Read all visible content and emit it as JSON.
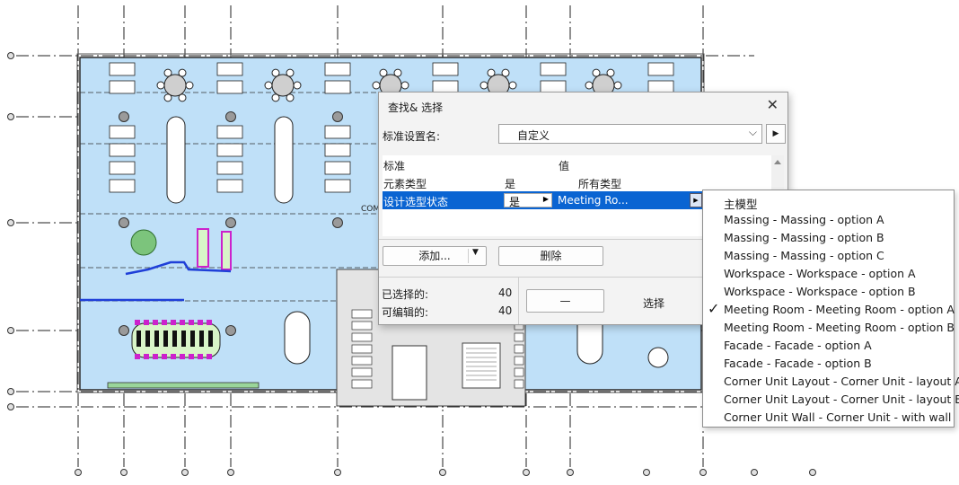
{
  "grid_bubbles": {
    "count_left": 6,
    "count_bottom": 12
  },
  "plan_labels": {
    "com_label": "COM"
  },
  "dialog": {
    "title": "查找& 选择",
    "close_glyph": "✕",
    "standard_set_label": "标准设置名:",
    "standard_set_value": "自定义",
    "table_headers": {
      "criterion": "标准",
      "value": "值"
    },
    "rows": [
      {
        "name": "元素类型",
        "op": "是",
        "value": "所有类型"
      },
      {
        "name": "设计选型状态",
        "op": "是",
        "value": "Meeting Ro..."
      }
    ],
    "add_button": "添加...",
    "delete_button": "删除",
    "selected_label": "已选择的:",
    "selected_count": "40",
    "editable_label": "可编辑的:",
    "editable_count": "40",
    "minus_button": "—",
    "select_button": "选择"
  },
  "dropdown": {
    "items": [
      {
        "label": "主模型",
        "checked": false
      },
      {
        "label": "Massing - Massing - option A",
        "checked": false
      },
      {
        "label": "Massing - Massing - option B",
        "checked": false
      },
      {
        "label": "Massing - Massing - option C",
        "checked": false
      },
      {
        "label": "Workspace - Workspace - option A",
        "checked": false
      },
      {
        "label": "Workspace - Workspace - option B",
        "checked": false
      },
      {
        "label": "Meeting Room - Meeting Room - option A",
        "checked": true
      },
      {
        "label": "Meeting Room - Meeting Room - option B",
        "checked": false
      },
      {
        "label": "Facade - Facade - option A",
        "checked": false
      },
      {
        "label": "Facade - Facade - option B",
        "checked": false
      },
      {
        "label": "Corner Unit Layout - Corner Unit - layout A",
        "checked": false
      },
      {
        "label": "Corner Unit Layout - Corner Unit - layout B",
        "checked": false
      },
      {
        "label": "Corner Unit Wall - Corner Unit - with wall",
        "checked": false
      }
    ],
    "check_glyph": "✓"
  },
  "colors": {
    "floor_fill": "#bfe0f8",
    "selection_blue": "#0a64d2",
    "highlight_magenta": "#cc22cc",
    "highlight_green": "#7cc47c"
  }
}
